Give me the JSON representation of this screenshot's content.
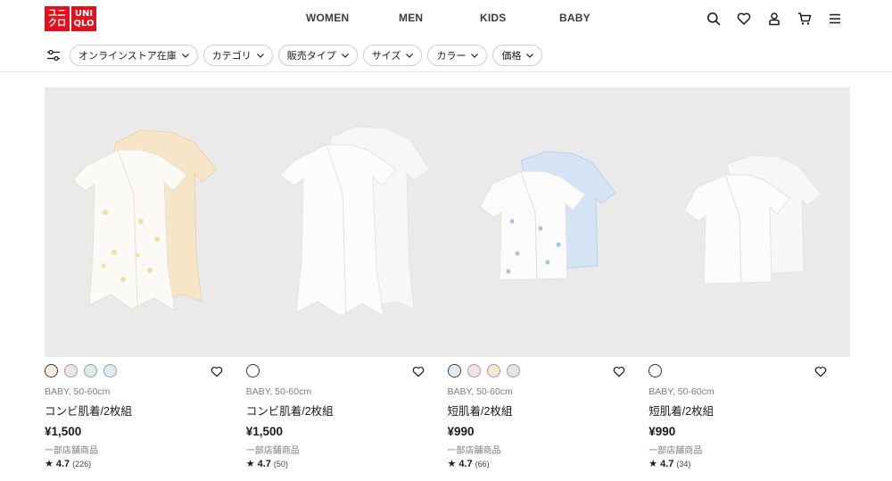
{
  "brand": {
    "logo_left": [
      "ユニ",
      "クロ"
    ],
    "logo_right": [
      "UNI",
      "QLO"
    ],
    "color": "#e5101d"
  },
  "nav": {
    "items": [
      "WOMEN",
      "MEN",
      "KIDS",
      "BABY"
    ]
  },
  "header_icons": [
    "search-icon",
    "heart-icon",
    "user-icon",
    "cart-icon",
    "menu-icon"
  ],
  "filters": {
    "icon": "sliders-icon",
    "chips": [
      "オンラインストア在庫",
      "カテゴリ",
      "販売タイプ",
      "サイズ",
      "カラー",
      "価格"
    ]
  },
  "products": [
    {
      "gender": "BABY, 50-60cm",
      "name": "コンビ肌着/2枚組",
      "price": "¥1,500",
      "note": "一部店舗商品",
      "rating": "4.7",
      "reviews": "(226)",
      "swatches": [
        "#f7ecd6",
        "#f3e3e0",
        "#dcebed",
        "#dfe9f4"
      ],
      "image": "onesie-cream-white"
    },
    {
      "gender": "BABY, 50-60cm",
      "name": "コンビ肌着/2枚組",
      "price": "¥1,500",
      "note": "一部店舗商品",
      "rating": "4.7",
      "reviews": "(50)",
      "swatches": [
        "#ffffff"
      ],
      "image": "onesie-white"
    },
    {
      "gender": "BABY, 50-60cm",
      "name": "短肌着/2枚組",
      "price": "¥990",
      "note": "一部店舗商品",
      "rating": "4.7",
      "reviews": "(66)",
      "swatches": [
        "#dce8f3",
        "#f3e3e0",
        "#f7e7cf",
        "#e2e6ea"
      ],
      "image": "shirt-blue-white"
    },
    {
      "gender": "BABY, 50-60cm",
      "name": "短肌着/2枚組",
      "price": "¥990",
      "note": "一部店舗商品",
      "rating": "4.7",
      "reviews": "(34)",
      "swatches": [
        "#ffffff"
      ],
      "image": "shirt-white"
    }
  ]
}
